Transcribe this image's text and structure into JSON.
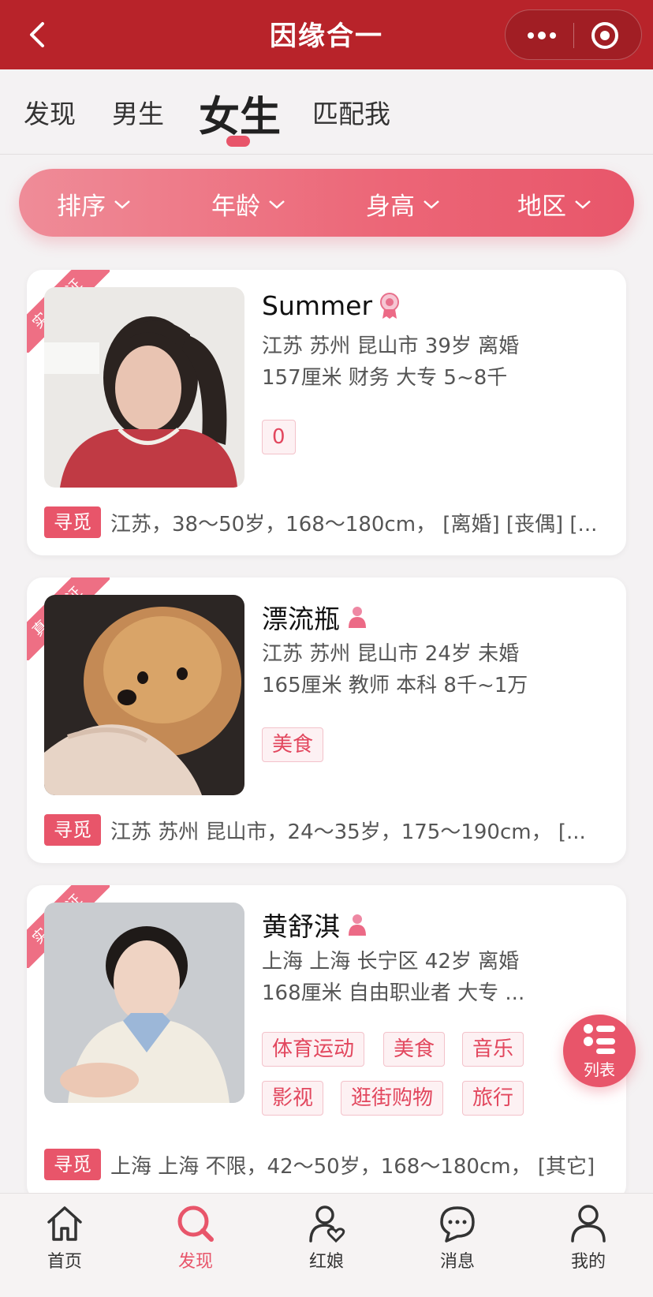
{
  "header": {
    "title": "因缘合一"
  },
  "tabs": [
    {
      "label": "发现"
    },
    {
      "label": "男生"
    },
    {
      "label": "女生"
    },
    {
      "label": "匹配我"
    }
  ],
  "active_tab": "女生",
  "filters": [
    {
      "label": "排序"
    },
    {
      "label": "年龄"
    },
    {
      "label": "身高"
    },
    {
      "label": "地区"
    }
  ],
  "cards": [
    {
      "ribbon": "实名认证",
      "name": "Summer",
      "line1": "江苏 苏州 昆山市    39岁    离婚",
      "line2": "157厘米    财务    大专    5~8千",
      "tags": [
        "0"
      ],
      "seek_label": "寻觅",
      "seek_text": "江苏，38～50岁，168～180cm，  [离婚] [丧偶] [..."
    },
    {
      "ribbon": "真人认证",
      "name": "漂流瓶",
      "line1": "江苏 苏州 昆山市    24岁    未婚",
      "line2": "165厘米    教师    本科    8千~1万",
      "tags": [
        "美食"
      ],
      "seek_label": "寻觅",
      "seek_text": "江苏 苏州 昆山市，24～35岁，175～190cm，  [..."
    },
    {
      "ribbon": "实名认证",
      "name": "黄舒淇",
      "line1": "上海 上海 长宁区    42岁    离婚",
      "line2": "168厘米    自由职业者    大专    ...",
      "tags": [
        "体育运动",
        "美食",
        "音乐",
        "影视",
        "逛街购物",
        "旅行"
      ],
      "seek_label": "寻觅",
      "seek_text": "上海 上海 不限，42～50岁，168～180cm，  [其它]"
    }
  ],
  "fab": {
    "label": "列表"
  },
  "bottom_nav": [
    {
      "label": "首页",
      "icon": "home-icon"
    },
    {
      "label": "发现",
      "icon": "search-icon"
    },
    {
      "label": "红娘",
      "icon": "matchmaker-icon"
    },
    {
      "label": "消息",
      "icon": "message-icon"
    },
    {
      "label": "我的",
      "icon": "profile-icon"
    }
  ],
  "colors": {
    "header": "#b8232a",
    "accent": "#e8556a",
    "tag_text": "#e2475e"
  }
}
